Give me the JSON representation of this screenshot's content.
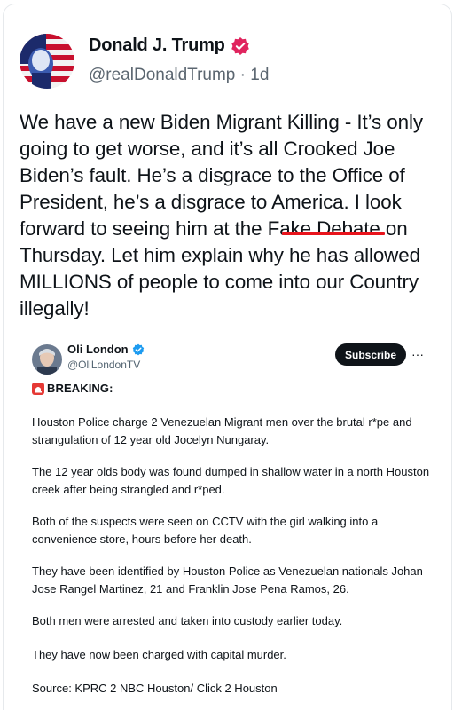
{
  "tweet": {
    "author_name": "Donald J. Trump",
    "handle": "@realDonaldTrump",
    "separator": "·",
    "time": "1d",
    "text_before_highlight": "We have a new Biden Migrant Killing - It’s only going to get worse, and it’s all Crooked Joe Biden’s fault. He’s a disgrace to the Office of President, he’s a disgrace to America. I look forward to seeing him at the ",
    "highlighted_text": "Fake Debate",
    "text_after_highlight": " on Thursday. Let him explain why he has allowed MILLIONS of people to come into our Country illegally!"
  },
  "embedded": {
    "author_name": "Oli London",
    "handle": "@OliLondonTV",
    "subscribe_label": "Subscribe",
    "more_label": "···",
    "breaking_label": "BREAKING:",
    "paragraphs": [
      "Houston Police charge 2 Venezuelan Migrant men over the brutal r*pe and strangulation of 12 year old Jocelyn Nungaray.",
      "The 12 year olds body was found dumped in shallow water in a north Houston creek after being strangled and r*ped.",
      "Both of the suspects were seen on CCTV with the girl walking into a convenience store, hours before her death.",
      "They have been identified by Houston Police as Venezuelan nationals Johan Jose Rangel Martinez, 21 and Franklin Jose Pena Ramos, 26.",
      "Both men were arrested and taken into custody earlier today.",
      "They have now been charged with capital murder.",
      "Source: KPRC 2 NBC Houston/ Click 2 Houston"
    ]
  },
  "colors": {
    "verified_badge_main": "#e0245e",
    "verified_badge_embed": "#1d9bf0",
    "highlight_underline": "#e8141c",
    "siren": "#e53935"
  }
}
